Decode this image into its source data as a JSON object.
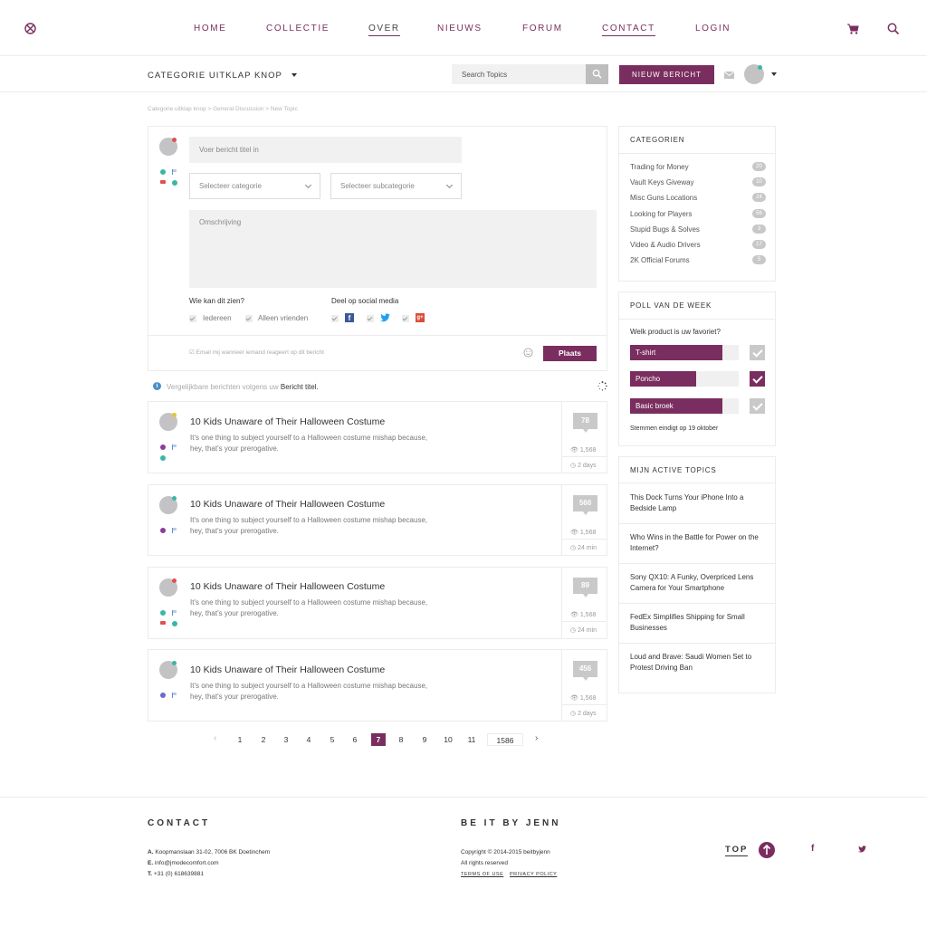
{
  "nav": {
    "items": [
      "HOME",
      "COLLECTIE",
      "OVER",
      "NIEUWS",
      "FORUM",
      "CONTACT",
      "LOGIN"
    ]
  },
  "subbar": {
    "category_toggle": "CATEGORIE UITKLAP KNOP",
    "search_placeholder": "Search Topics",
    "new_post": "NIEUW BERICHT"
  },
  "breadcrumb": "Categorie uitklap knop > General Discussion > New Topic",
  "composer": {
    "title_placeholder": "Voer bericht titel in",
    "category_select": "Selecteer categorie",
    "subcategory_select": "Selecteer subcategorie",
    "description_placeholder": "Omschrijving",
    "visibility_label": "Wie kan dit zien?",
    "visibility_everyone": "Iedereen",
    "visibility_friends": "Alleen vrienden",
    "share_label": "Deel op social media",
    "email_notify": "Email mij wanneer iemand reageert op dit bericht",
    "submit": "Plaats"
  },
  "similar": {
    "text": "Vergelijkbare berichten volgens uw",
    "bold": "Bericht titel."
  },
  "topics": [
    {
      "title": "10 Kids Unaware of Their Halloween Costume",
      "desc": "It's one thing to subject yourself to a Halloween costume mishap because, hey, that's your prerogative.",
      "count": "78",
      "views": "1,568",
      "time": "2 days"
    },
    {
      "title": "10 Kids Unaware of Their Halloween Costume",
      "desc": "It's one thing to subject yourself to a Halloween costume mishap because, hey, that's your prerogative.",
      "count": "560",
      "views": "1,568",
      "time": "24 min"
    },
    {
      "title": "10 Kids Unaware of Their Halloween Costume",
      "desc": "It's one thing to subject yourself to a Halloween costume mishap because, hey, that's your prerogative.",
      "count": "89",
      "views": "1,568",
      "time": "24 min"
    },
    {
      "title": "10 Kids Unaware of Their Halloween Costume",
      "desc": "It's one thing to subject yourself to a Halloween costume mishap because, hey, that's your prerogative.",
      "count": "456",
      "views": "1,568",
      "time": "2 days"
    }
  ],
  "pagination": {
    "pages": [
      "1",
      "2",
      "3",
      "4",
      "5",
      "6",
      "7",
      "8",
      "9",
      "10",
      "11",
      "1586"
    ],
    "active": "7"
  },
  "categories": {
    "title": "CATEGORIEN",
    "items": [
      {
        "label": "Trading for Money",
        "count": "20"
      },
      {
        "label": "Vault Keys Giveway",
        "count": "10"
      },
      {
        "label": "Misc Guns Locations",
        "count": "24"
      },
      {
        "label": "Looking for Players",
        "count": "56"
      },
      {
        "label": "Stupid Bugs & Solves",
        "count": "3"
      },
      {
        "label": "Video & Audio Drivers",
        "count": "17"
      },
      {
        "label": "2K Official Forums",
        "count": "5"
      }
    ]
  },
  "poll": {
    "title": "POLL VAN DE WEEK",
    "question": "Welk product is uw favoriet?",
    "options": [
      {
        "label": "T-shirt",
        "fill": 0.85,
        "selected": false
      },
      {
        "label": "Poncho",
        "fill": 0.61,
        "selected": true
      },
      {
        "label": "Basic broek",
        "fill": 0.85,
        "selected": false
      }
    ],
    "footer": "Stemmen eindigt op 19 oktober"
  },
  "active_topics": {
    "title": "MIJN ACTIVE TOPICS",
    "items": [
      "This Dock Turns Your iPhone Into a Bedside Lamp",
      "Who Wins in the Battle for Power on the Internet?",
      "Sony QX10: A Funky, Overpriced Lens Camera for Your Smartphone",
      "FedEx Simplifies Shipping for Small Businesses",
      "Loud and Brave: Saudi Women Set to Protest Driving Ban"
    ]
  },
  "footer": {
    "contact_title": "CONTACT",
    "address_label": "A.",
    "address": "Koopmanslaan 31-02, 7006 BK Doetinchem",
    "email_label": "E.",
    "email": "info@jmodecomfort.com",
    "phone_label": "T.",
    "phone": "+31 (0) 618639881",
    "brand_title": "BE IT BY JENN",
    "copyright": "Copyright © 2014-2015 beitbyjenn",
    "rights": "All rights reserved",
    "terms": "TERMS OF USE",
    "privacy": "PRIVACY POLICY",
    "top": "TOP"
  },
  "colors": {
    "accent": "#7a2e5f",
    "badge_gray": "#c9c9c9"
  }
}
